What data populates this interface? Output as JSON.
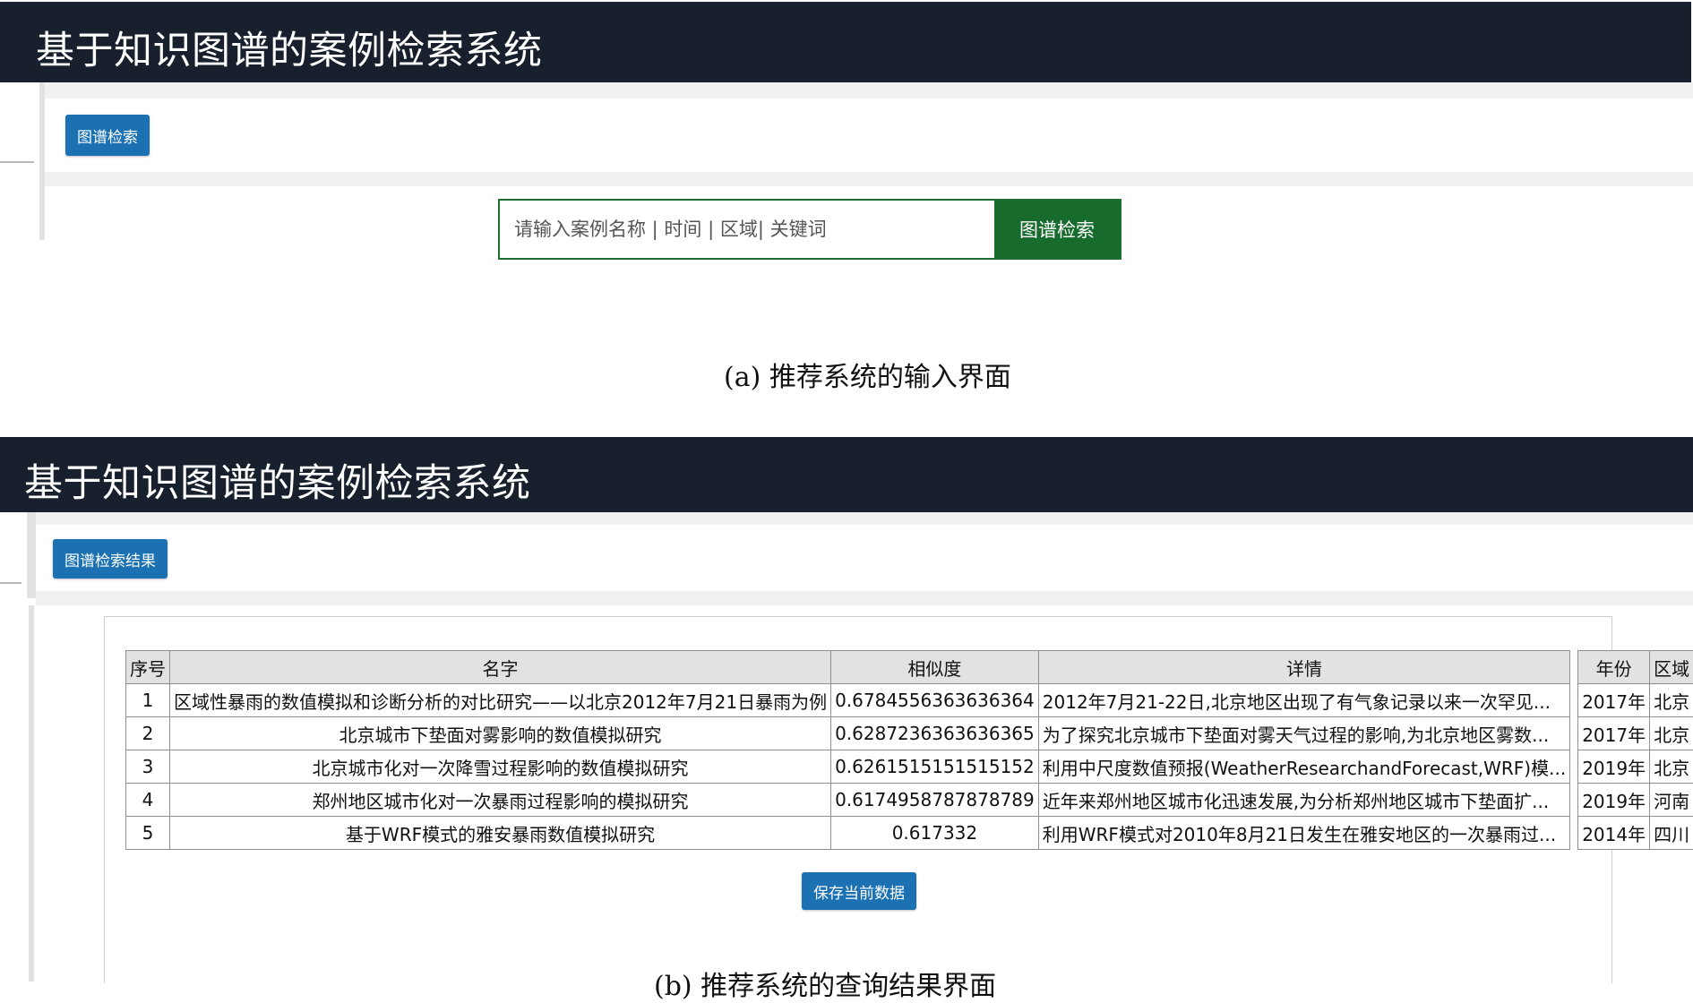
{
  "panel_a": {
    "header_title": "基于知识图谱的案例检索系统",
    "tab_button": "图谱检索",
    "search": {
      "placeholder": "请输入案例名称 | 时间 | 区域| 关键词",
      "button_label": "图谱检索"
    },
    "caption": "(a) 推荐系统的输入界面"
  },
  "panel_b": {
    "header_title": "基于知识图谱的案例检索系统",
    "tab_button": "图谱检索结果",
    "table": {
      "columns": [
        "序号",
        "名字",
        "相似度",
        "详情",
        "年份",
        "区域"
      ],
      "rows": [
        [
          "1",
          "区域性暴雨的数值模拟和诊断分析的对比研究——以北京2012年7月21日暴雨为例",
          "0.6784556363636364",
          "2012年7月21-22日,北京地区出现了有气象记录以来一次罕见...",
          "2017年",
          "北京"
        ],
        [
          "2",
          "北京城市下垫面对雾影响的数值模拟研究",
          "0.6287236363636365",
          "为了探究北京城市下垫面对雾天气过程的影响,为北京地区雾数...",
          "2017年",
          "北京"
        ],
        [
          "3",
          "北京城市化对一次降雪过程影响的数值模拟研究",
          "0.6261515151515152",
          "利用中尺度数值预报(WeatherResearchandForecast,WRF)模...",
          "2019年",
          "北京"
        ],
        [
          "4",
          "郑州地区城市化对一次暴雨过程影响的模拟研究",
          "0.6174958787878789",
          "近年来郑州地区城市化迅速发展,为分析郑州地区城市下垫面扩...",
          "2019年",
          "河南"
        ],
        [
          "5",
          "基于WRF模式的雅安暴雨数值模拟研究",
          "0.617332",
          "利用WRF模式对2010年8月21日发生在雅安地区的一次暴雨过...",
          "2014年",
          "四川"
        ]
      ]
    },
    "save_button": "保存当前数据",
    "caption": "(b) 推荐系统的查询结果界面"
  },
  "colors": {
    "header_bg": "#17202c",
    "primary_blue": "#1c71b3",
    "search_green": "#176b2d"
  }
}
